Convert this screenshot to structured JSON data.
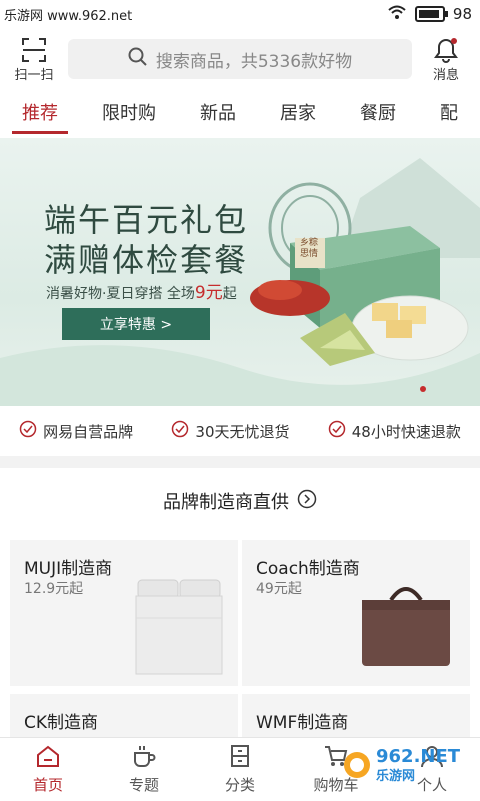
{
  "statusbar": {
    "left_text": "乐游网 www.962.net",
    "battery": "98"
  },
  "header": {
    "scan_label": "扫一扫",
    "search_placeholder": "搜索商品，共5336款好物",
    "messages_label": "消息"
  },
  "tabs": [
    {
      "label": "推荐"
    },
    {
      "label": "限时购"
    },
    {
      "label": "新品"
    },
    {
      "label": "居家"
    },
    {
      "label": "餐厨"
    },
    {
      "label": "配"
    }
  ],
  "banner": {
    "line1": "端午百元礼包",
    "line2": "满赠体检套餐",
    "sub_text": "消暑好物·夏日穿搭 全场",
    "sub_price": "9元",
    "sub_suffix": "起",
    "cta": "立享特惠 >",
    "box_label": "乡粽 思情"
  },
  "promises": [
    {
      "label": "网易自营品牌"
    },
    {
      "label": "30天无忧退货"
    },
    {
      "label": "48小时快速退款"
    }
  ],
  "section": {
    "title": "品牌制造商直供",
    "cards": [
      {
        "name": "MUJI制造商",
        "price": "12.9元起"
      },
      {
        "name": "Coach制造商",
        "price": "49元起"
      },
      {
        "name": "CK制造商",
        "price": ""
      },
      {
        "name": "WMF制造商",
        "price": ""
      }
    ]
  },
  "bottomnav": [
    {
      "label": "首页"
    },
    {
      "label": "专题"
    },
    {
      "label": "分类"
    },
    {
      "label": "购物车"
    },
    {
      "label": "个人"
    }
  ],
  "watermark": {
    "text": "962.NET",
    "sub": "乐游网"
  },
  "colors": {
    "accent": "#b4282d",
    "banner_green": "#2e6e5a"
  }
}
